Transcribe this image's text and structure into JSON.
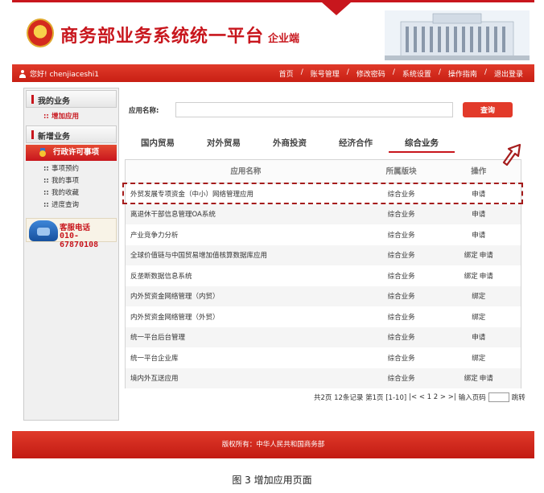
{
  "header": {
    "title": "商务部业务系统统一平台",
    "subtitle": "企业端"
  },
  "navbar": {
    "greeting": "您好! chenjiaceshi1",
    "links": [
      "首页",
      "账号管理",
      "修改密码",
      "系统设置",
      "操作指南",
      "退出登录"
    ]
  },
  "sidebar": {
    "section1": "我的业务",
    "section1_items": [
      "增加应用"
    ],
    "section2": "新增业务",
    "admin_item": "行政许可事项",
    "items": [
      "事项预约",
      "我的事项",
      "我的收藏",
      "进度查询"
    ],
    "service_label": "客服电话",
    "service_phone": "010-67870108"
  },
  "search": {
    "label": "应用名称:",
    "value": "",
    "placeholder": "",
    "button": "查询"
  },
  "tabs": [
    "国内贸易",
    "对外贸易",
    "外商投资",
    "经济合作",
    "综合业务"
  ],
  "active_tab": 4,
  "table": {
    "headers": [
      "应用名称",
      "所属版块",
      "操作"
    ],
    "rows": [
      {
        "name": "外贸发展专项资金（中小）网络管理应用",
        "section": "综合业务",
        "ops": [
          "申请"
        ]
      },
      {
        "name": "离退休干部信息管理OA系统",
        "section": "综合业务",
        "ops": [
          "申请"
        ]
      },
      {
        "name": "产业竞争力分析",
        "section": "综合业务",
        "ops": [
          "申请"
        ]
      },
      {
        "name": "全球价值链与中国贸易增加值核算数据库应用",
        "section": "综合业务",
        "ops": [
          "绑定",
          "申请"
        ]
      },
      {
        "name": "反垄断数据信息系统",
        "section": "综合业务",
        "ops": [
          "绑定",
          "申请"
        ]
      },
      {
        "name": "内外贸资金网络管理（内贸）",
        "section": "综合业务",
        "ops": [
          "绑定"
        ]
      },
      {
        "name": "内外贸资金网络管理（外贸）",
        "section": "综合业务",
        "ops": [
          "绑定"
        ]
      },
      {
        "name": "统一平台后台管理",
        "section": "综合业务",
        "ops": [
          "申请"
        ]
      },
      {
        "name": "统一平台企业库",
        "section": "综合业务",
        "ops": [
          "绑定"
        ]
      },
      {
        "name": "境内外互送应用",
        "section": "综合业务",
        "ops": [
          "绑定",
          "申请"
        ]
      }
    ]
  },
  "pager": {
    "summary": "共2页 12条记录 第1页 [1-10]",
    "nav": "|< < 1 2 > >|",
    "goto_label": "输入页码",
    "jump": "跳转"
  },
  "footer": {
    "text": "版权所有：中华人民共和国商务部"
  },
  "caption": "图 3   增加应用页面",
  "colors": {
    "brand_red": "#c8161d",
    "highlight": "#a51c1c"
  }
}
